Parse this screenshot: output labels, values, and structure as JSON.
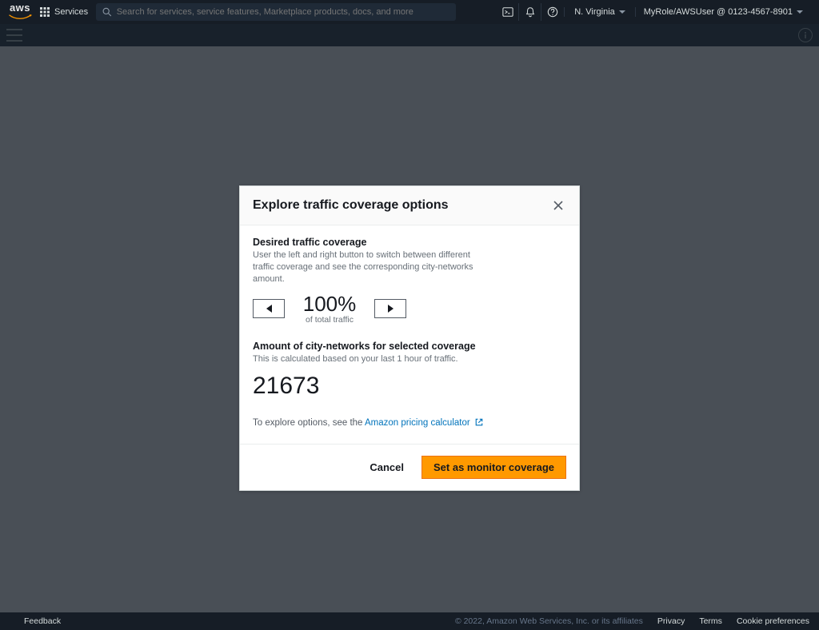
{
  "topnav": {
    "logo_text": "aws",
    "services_label": "Services",
    "search_placeholder": "Search for services, service features, Marketplace products, docs, and more",
    "region": "N. Virginia",
    "user": "MyRole/AWSUser @ 0123-4567-8901"
  },
  "modal": {
    "title": "Explore traffic coverage options",
    "section1_label": "Desired traffic coverage",
    "section1_desc": "User the left and right button to switch between different traffic coverage and see the corresponding city-networks amount.",
    "coverage_value": "100%",
    "coverage_sub": "of total traffic",
    "section2_label": "Amount of city-networks for selected coverage",
    "section2_desc": "This is calculated based on your last 1 hour of traffic.",
    "city_networks": "21673",
    "explore_prefix": "To explore options, see the",
    "explore_link": "Amazon pricing calculator",
    "cancel": "Cancel",
    "primary": "Set as monitor coverage"
  },
  "footer": {
    "feedback": "Feedback",
    "copyright": "© 2022, Amazon Web Services, Inc. or its affiliates",
    "privacy": "Privacy",
    "terms": "Terms",
    "cookies": "Cookie preferences"
  }
}
